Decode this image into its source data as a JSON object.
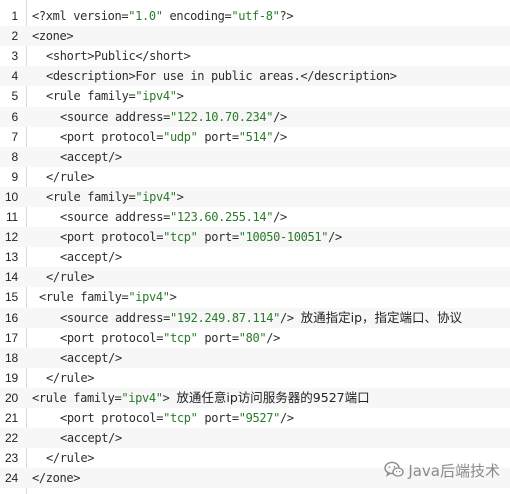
{
  "editor": {
    "lines": [
      {
        "num": "1",
        "indent": 0,
        "parts": [
          {
            "t": "<?xml version=",
            "c": "tag"
          },
          {
            "t": "\"1.0\"",
            "c": "str"
          },
          {
            "t": " encoding=",
            "c": "tag"
          },
          {
            "t": "\"utf-8\"",
            "c": "str"
          },
          {
            "t": "?>",
            "c": "tag"
          }
        ]
      },
      {
        "num": "2",
        "indent": 0,
        "parts": [
          {
            "t": "<zone>",
            "c": "tag"
          }
        ]
      },
      {
        "num": "3",
        "indent": 1,
        "parts": [
          {
            "t": "<short>Public</short>",
            "c": "tag"
          }
        ]
      },
      {
        "num": "4",
        "indent": 1,
        "parts": [
          {
            "t": "<description>For use in public areas.</description>",
            "c": "tag"
          }
        ]
      },
      {
        "num": "5",
        "indent": 1,
        "parts": [
          {
            "t": "<rule family=",
            "c": "tag"
          },
          {
            "t": "\"ipv4\"",
            "c": "str"
          },
          {
            "t": ">",
            "c": "tag"
          }
        ]
      },
      {
        "num": "6",
        "indent": 2,
        "parts": [
          {
            "t": "<source address=",
            "c": "tag"
          },
          {
            "t": "\"122.10.70.234\"",
            "c": "str"
          },
          {
            "t": "/>",
            "c": "tag"
          }
        ]
      },
      {
        "num": "7",
        "indent": 2,
        "parts": [
          {
            "t": "<port protocol=",
            "c": "tag"
          },
          {
            "t": "\"udp\"",
            "c": "str"
          },
          {
            "t": " port=",
            "c": "tag"
          },
          {
            "t": "\"514\"",
            "c": "str"
          },
          {
            "t": "/>",
            "c": "tag"
          }
        ]
      },
      {
        "num": "8",
        "indent": 2,
        "parts": [
          {
            "t": "<accept/>",
            "c": "tag"
          }
        ]
      },
      {
        "num": "9",
        "indent": 1,
        "parts": [
          {
            "t": "</rule>",
            "c": "tag"
          }
        ]
      },
      {
        "num": "10",
        "indent": 1,
        "parts": [
          {
            "t": "<rule family=",
            "c": "tag"
          },
          {
            "t": "\"ipv4\"",
            "c": "str"
          },
          {
            "t": ">",
            "c": "tag"
          }
        ]
      },
      {
        "num": "11",
        "indent": 2,
        "parts": [
          {
            "t": "<source address=",
            "c": "tag"
          },
          {
            "t": "\"123.60.255.14\"",
            "c": "str"
          },
          {
            "t": "/>",
            "c": "tag"
          }
        ]
      },
      {
        "num": "12",
        "indent": 2,
        "parts": [
          {
            "t": "<port protocol=",
            "c": "tag"
          },
          {
            "t": "\"tcp\"",
            "c": "str"
          },
          {
            "t": " port=",
            "c": "tag"
          },
          {
            "t": "\"10050-10051\"",
            "c": "str"
          },
          {
            "t": "/>",
            "c": "tag"
          }
        ]
      },
      {
        "num": "13",
        "indent": 2,
        "parts": [
          {
            "t": "<accept/>",
            "c": "tag"
          }
        ]
      },
      {
        "num": "14",
        "indent": 1,
        "parts": [
          {
            "t": "</rule>",
            "c": "tag"
          }
        ]
      },
      {
        "num": "15",
        "indent": 0.5,
        "parts": [
          {
            "t": "<rule family=",
            "c": "tag"
          },
          {
            "t": "\"ipv4\"",
            "c": "str"
          },
          {
            "t": ">",
            "c": "tag"
          }
        ]
      },
      {
        "num": "16",
        "indent": 2,
        "parts": [
          {
            "t": "<source address=",
            "c": "tag"
          },
          {
            "t": "\"192.249.87.114\"",
            "c": "str"
          },
          {
            "t": "/> ",
            "c": "tag"
          },
          {
            "t": "放通指定ip，指定端口、协议",
            "c": "cmt"
          }
        ]
      },
      {
        "num": "17",
        "indent": 2,
        "parts": [
          {
            "t": "<port protocol=",
            "c": "tag"
          },
          {
            "t": "\"tcp\"",
            "c": "str"
          },
          {
            "t": " port=",
            "c": "tag"
          },
          {
            "t": "\"80\"",
            "c": "str"
          },
          {
            "t": "/>",
            "c": "tag"
          }
        ]
      },
      {
        "num": "18",
        "indent": 2,
        "parts": [
          {
            "t": "<accept/>",
            "c": "tag"
          }
        ]
      },
      {
        "num": "19",
        "indent": 1,
        "parts": [
          {
            "t": "</rule>",
            "c": "tag"
          }
        ]
      },
      {
        "num": "20",
        "indent": 0,
        "parts": [
          {
            "t": "<rule family=",
            "c": "tag"
          },
          {
            "t": "\"ipv4\"",
            "c": "str"
          },
          {
            "t": "> ",
            "c": "tag"
          },
          {
            "t": "放通任意ip访问服务器的9527端口",
            "c": "cmt"
          }
        ]
      },
      {
        "num": "21",
        "indent": 2,
        "parts": [
          {
            "t": "<port protocol=",
            "c": "tag"
          },
          {
            "t": "\"tcp\"",
            "c": "str"
          },
          {
            "t": " port=",
            "c": "tag"
          },
          {
            "t": "\"9527\"",
            "c": "str"
          },
          {
            "t": "/>",
            "c": "tag"
          }
        ]
      },
      {
        "num": "22",
        "indent": 2,
        "parts": [
          {
            "t": "<accept/>",
            "c": "tag"
          }
        ]
      },
      {
        "num": "23",
        "indent": 1,
        "parts": [
          {
            "t": "</rule>",
            "c": "tag"
          }
        ]
      },
      {
        "num": "24",
        "indent": 0,
        "parts": [
          {
            "t": "</zone>",
            "c": "tag"
          }
        ]
      }
    ]
  },
  "watermark": {
    "text": "Java后端技术",
    "icon": "wechat-icon"
  },
  "colors": {
    "string": "#2b7a2b",
    "tag": "#2d2d2d",
    "line_number": "#222222",
    "watermark": "#8a8a8a"
  }
}
